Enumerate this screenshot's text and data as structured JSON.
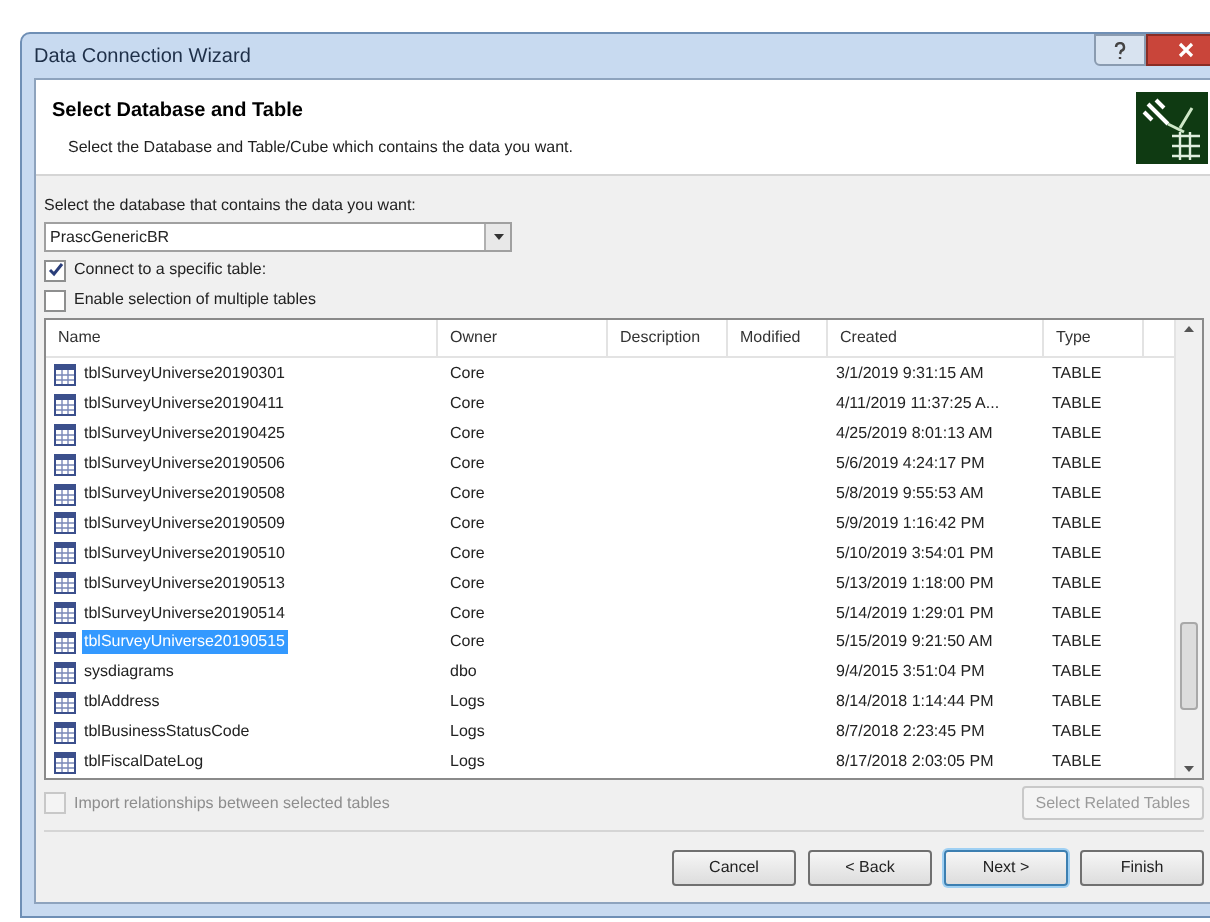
{
  "window": {
    "title": "Data Connection Wizard"
  },
  "header": {
    "title": "Select Database and Table",
    "subtitle": "Select the Database and Table/Cube which contains the data you want."
  },
  "database": {
    "label": "Select the database that contains the data you want:",
    "value": "PrascGenericBR"
  },
  "options": [
    {
      "label": "Connect to a specific table:",
      "checked": true
    },
    {
      "label": "Enable selection of multiple tables",
      "checked": false
    }
  ],
  "table": {
    "columns": [
      "Name",
      "Owner",
      "Description",
      "Modified",
      "Created",
      "Type"
    ],
    "rows": [
      {
        "name": "tblSurveyUniverse20190301",
        "owner": "Core",
        "created": "3/1/2019 9:31:15 AM",
        "type": "TABLE",
        "selected": false
      },
      {
        "name": "tblSurveyUniverse20190411",
        "owner": "Core",
        "created": "4/11/2019 11:37:25 A...",
        "type": "TABLE",
        "selected": false
      },
      {
        "name": "tblSurveyUniverse20190425",
        "owner": "Core",
        "created": "4/25/2019 8:01:13 AM",
        "type": "TABLE",
        "selected": false
      },
      {
        "name": "tblSurveyUniverse20190506",
        "owner": "Core",
        "created": "5/6/2019 4:24:17 PM",
        "type": "TABLE",
        "selected": false
      },
      {
        "name": "tblSurveyUniverse20190508",
        "owner": "Core",
        "created": "5/8/2019 9:55:53 AM",
        "type": "TABLE",
        "selected": false
      },
      {
        "name": "tblSurveyUniverse20190509",
        "owner": "Core",
        "created": "5/9/2019 1:16:42 PM",
        "type": "TABLE",
        "selected": false
      },
      {
        "name": "tblSurveyUniverse20190510",
        "owner": "Core",
        "created": "5/10/2019 3:54:01 PM",
        "type": "TABLE",
        "selected": false
      },
      {
        "name": "tblSurveyUniverse20190513",
        "owner": "Core",
        "created": "5/13/2019 1:18:00 PM",
        "type": "TABLE",
        "selected": false
      },
      {
        "name": "tblSurveyUniverse20190514",
        "owner": "Core",
        "created": "5/14/2019 1:29:01 PM",
        "type": "TABLE",
        "selected": false
      },
      {
        "name": "tblSurveyUniverse20190515",
        "owner": "Core",
        "created": "5/15/2019 9:21:50 AM",
        "type": "TABLE",
        "selected": true
      },
      {
        "name": "sysdiagrams",
        "owner": "dbo",
        "created": "9/4/2015 3:51:04 PM",
        "type": "TABLE",
        "selected": false
      },
      {
        "name": "tblAddress",
        "owner": "Logs",
        "created": "8/14/2018 1:14:44 PM",
        "type": "TABLE",
        "selected": false
      },
      {
        "name": "tblBusinessStatusCode",
        "owner": "Logs",
        "created": "8/7/2018 2:23:45 PM",
        "type": "TABLE",
        "selected": false
      },
      {
        "name": "tblFiscalDateLog",
        "owner": "Logs",
        "created": "8/17/2018 2:03:05 PM",
        "type": "TABLE",
        "selected": false
      }
    ]
  },
  "import_relationships": {
    "label": "Import relationships between selected tables",
    "checked": false,
    "disabled": true
  },
  "select_related": {
    "label": "Select Related Tables",
    "disabled": true
  },
  "buttons": [
    {
      "label": "Cancel",
      "default": false
    },
    {
      "label": "< Back",
      "default": false
    },
    {
      "label": "Next >",
      "default": true
    },
    {
      "label": "Finish",
      "default": false
    }
  ]
}
